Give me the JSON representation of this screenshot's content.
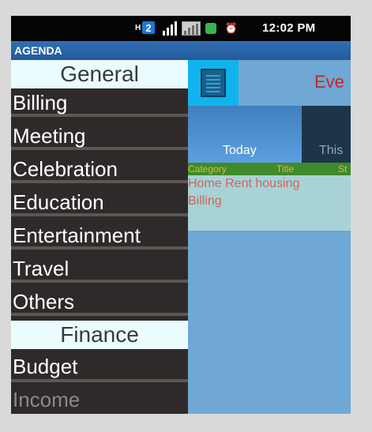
{
  "status_bar": {
    "network_label": "H",
    "sim_badge": "2",
    "time": "12:02 PM",
    "icons": [
      "signal-icon",
      "signal-icon",
      "battery-icon",
      "alarm-icon"
    ]
  },
  "app": {
    "title": "AGENDA"
  },
  "drawer": {
    "sections": [
      {
        "header": "General",
        "items": [
          "Billing",
          "Meeting",
          "Celebration",
          "Education",
          "Entertainment",
          "Travel",
          "Others"
        ]
      },
      {
        "header": "Finance",
        "items": [
          "Budget",
          "Income"
        ]
      }
    ]
  },
  "main": {
    "title_partial": "Eve",
    "tabs": [
      {
        "label": "Today",
        "selected": true
      },
      {
        "label": "This",
        "selected": false
      }
    ],
    "table": {
      "columns": [
        "Category",
        "Title",
        "St"
      ],
      "rows": [
        {
          "category": "Home Rent housing",
          "category_line2": "Billing"
        }
      ]
    }
  },
  "colors": {
    "background": "#6fa8d5",
    "drawer": "#2f2a29",
    "section_header": "#ebfcff",
    "title_bar": "#2f6fb6",
    "accent_red": "#c8232d"
  }
}
